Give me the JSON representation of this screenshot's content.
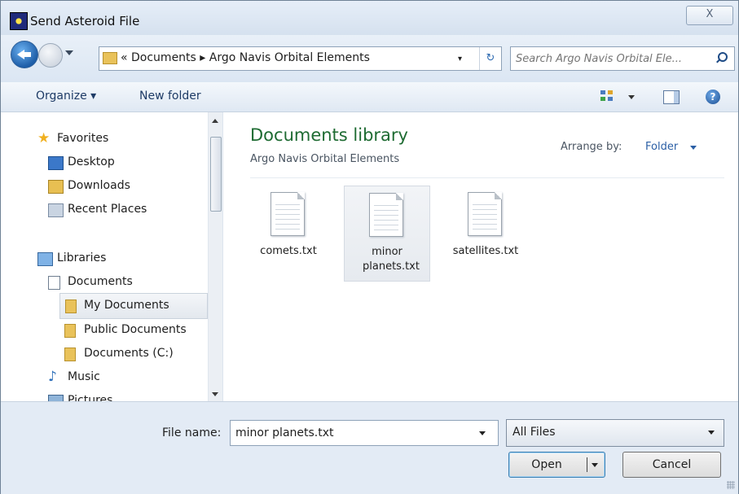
{
  "window": {
    "title": "Send Asteroid File",
    "close_label": "X"
  },
  "address": {
    "crumbs": "« Documents ▸ Argo Navis Orbital Elements",
    "dropdown_glyph": "▾",
    "refresh_glyph": "↻"
  },
  "search": {
    "placeholder": "Search Argo Navis Orbital Ele..."
  },
  "toolbar": {
    "organize_label": "Organize ▾",
    "new_folder_label": "New folder",
    "help_glyph": "?"
  },
  "nav": {
    "favorites": "Favorites",
    "desktop": "Desktop",
    "downloads": "Downloads",
    "recent": "Recent Places",
    "libraries": "Libraries",
    "documents": "Documents",
    "my_documents": "My Documents",
    "public_documents": "Public Documents",
    "documents_c": "Documents (C:)",
    "music": "Music",
    "pictures": "Pictures"
  },
  "library": {
    "title": "Documents library",
    "subtitle": "Argo Navis Orbital Elements",
    "arrange_label": "Arrange by:",
    "arrange_value": "Folder"
  },
  "files": [
    {
      "name": "comets.txt"
    },
    {
      "name": "minor planets.txt"
    },
    {
      "name": "satellites.txt"
    }
  ],
  "footer": {
    "file_name_label": "File name:",
    "file_name_value": "minor planets.txt",
    "file_type_value": "All Files",
    "open_label": "Open",
    "cancel_label": "Cancel"
  },
  "colors": {
    "library_title": "#1e6b32",
    "link": "#2b5fa5"
  }
}
